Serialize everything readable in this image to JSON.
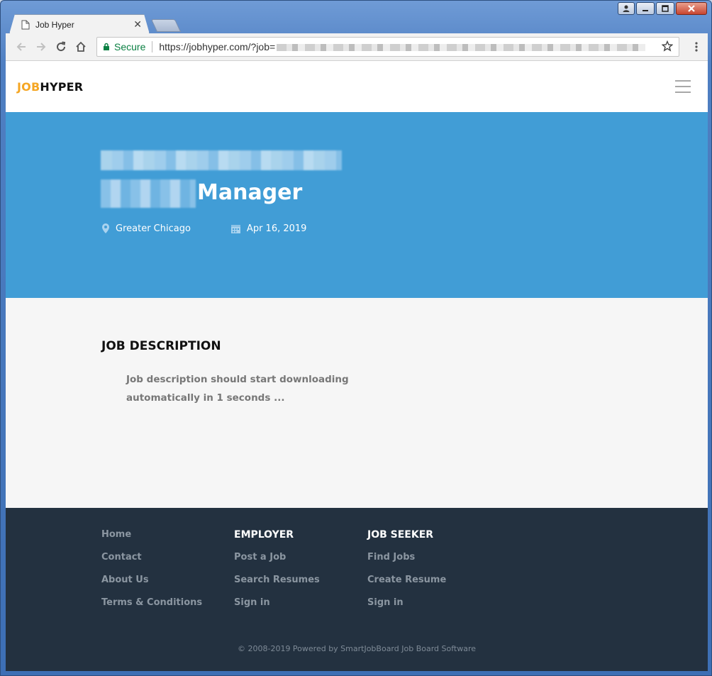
{
  "browser": {
    "tab_title": "Job Hyper",
    "secure_label": "Secure",
    "url_base": "https://jobhyper.com/?job="
  },
  "site": {
    "logo_part1": "JOB",
    "logo_part2": "HYPER",
    "accent_color": "#f5a623",
    "hero_color": "#419dd6",
    "footer_color": "#233140"
  },
  "job": {
    "title_visible": "Manager",
    "location": "Greater Chicago",
    "date": "Apr 16, 2019"
  },
  "description": {
    "heading": "JOB DESCRIPTION",
    "text": "Job description should start downloading automatically in 1 seconds ..."
  },
  "footer": {
    "col1": [
      "Home",
      "Contact",
      "About Us",
      "Terms & Conditions"
    ],
    "employer_heading": "EMPLOYER",
    "employer_links": [
      "Post a Job",
      "Search Resumes",
      "Sign in"
    ],
    "seeker_heading": "JOB SEEKER",
    "seeker_links": [
      "Find Jobs",
      "Create Resume",
      "Sign in"
    ],
    "copyright": "© 2008-2019 Powered by SmartJobBoard Job Board Software"
  }
}
